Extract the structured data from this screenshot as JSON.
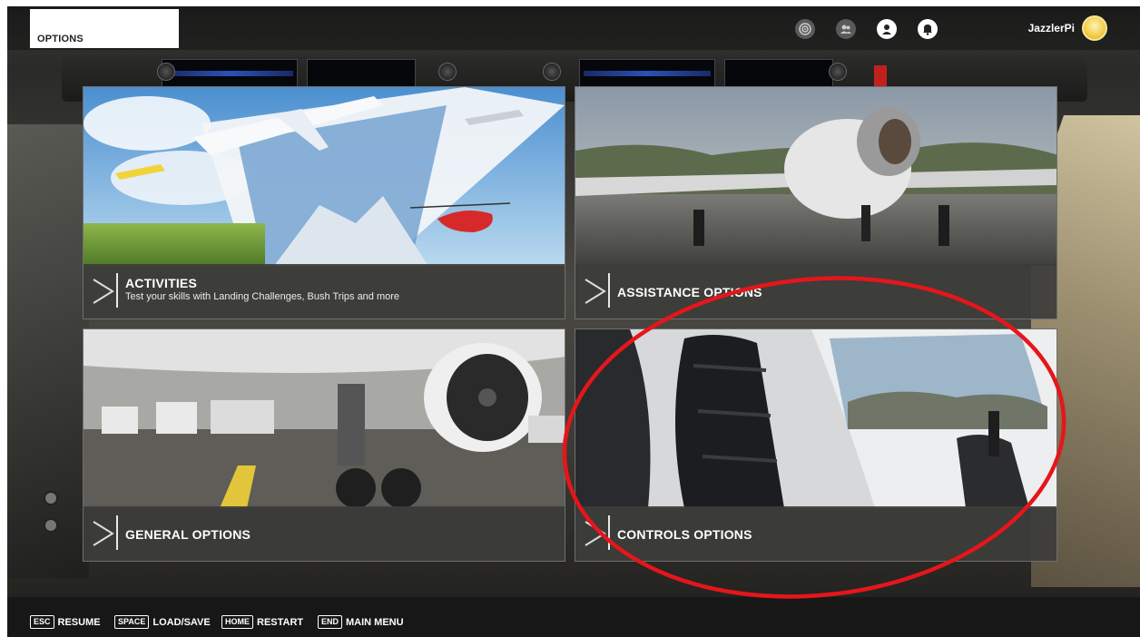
{
  "header": {
    "title": "OPTIONS",
    "username": "JazzlerPi",
    "icons": [
      "target-icon",
      "group-icon",
      "profile-icon",
      "notification-bell-icon"
    ]
  },
  "tiles": [
    {
      "id": "activities",
      "label": "ACTIVITIES",
      "subtitle": "Test your skills with Landing Challenges, Bush Trips and more"
    },
    {
      "id": "assistance",
      "label": "ASSISTANCE OPTIONS"
    },
    {
      "id": "general",
      "label": "GENERAL OPTIONS"
    },
    {
      "id": "controls",
      "label": "CONTROLS OPTIONS"
    }
  ],
  "bottom_bar": {
    "hints": [
      {
        "key": "ESC",
        "label": "RESUME"
      },
      {
        "key": "SPACE",
        "label": "LOAD/SAVE"
      },
      {
        "key": "HOME",
        "label": "RESTART"
      },
      {
        "key": "END",
        "label": "MAIN MENU"
      }
    ]
  },
  "colors": {
    "highlight": "#e5161b",
    "tile_footer": "#3c3c3a",
    "bottom_bar": "#171717"
  }
}
